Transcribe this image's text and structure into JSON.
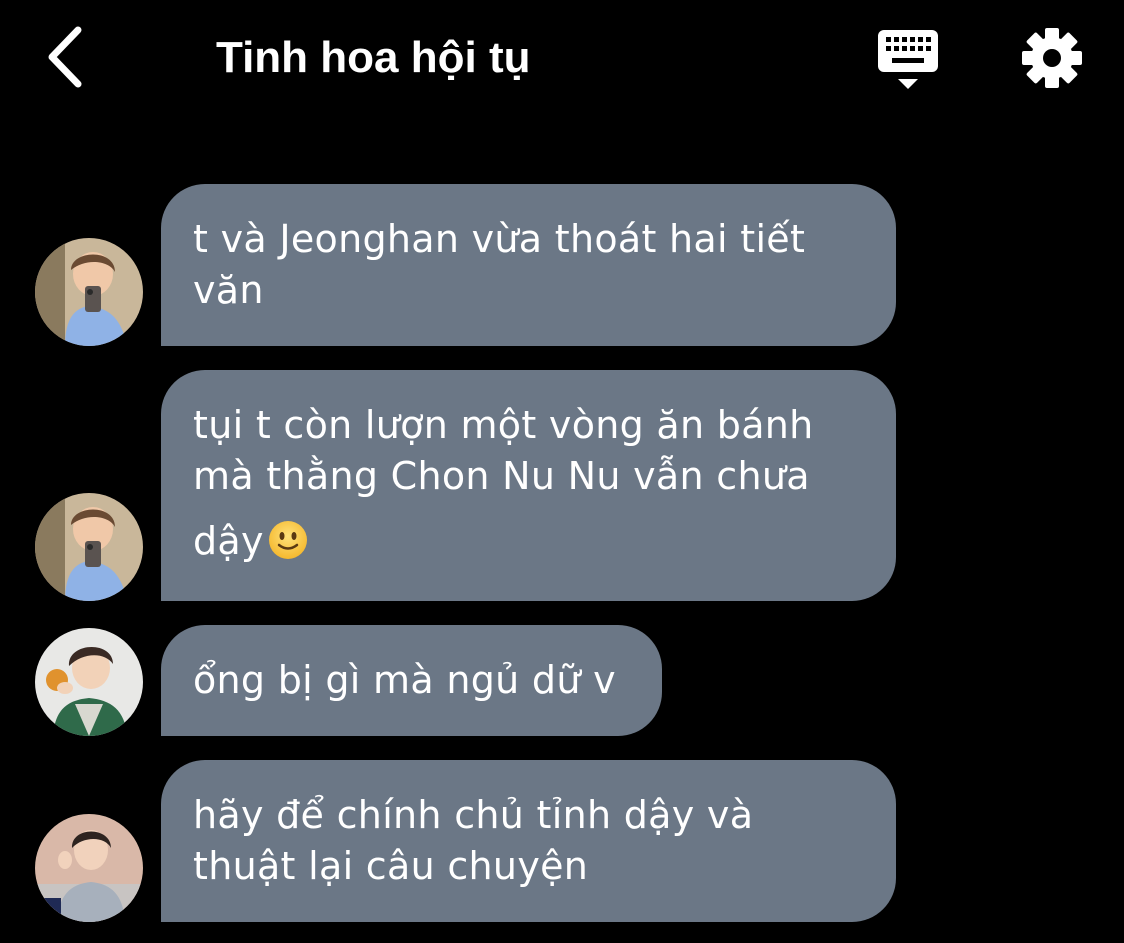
{
  "header": {
    "title": "Tinh hoa hội tụ",
    "back_icon": "chevron-left-icon",
    "keyboard_icon": "keyboard-icon",
    "settings_icon": "gear-icon"
  },
  "colors": {
    "background": "#000000",
    "bubble": "#6b7786",
    "text": "#ffffff"
  },
  "messages": [
    {
      "avatar": "avatar-1",
      "lines": [
        "t và Jeonghan vừa thoát hai tiết",
        "văn"
      ]
    },
    {
      "avatar": "avatar-1",
      "lines": [
        "tụi t còn lượn một vòng ăn bánh",
        "mà thằng Chon Nu Nu vẫn chưa",
        "dậy"
      ],
      "emoji": "slightly-smiling-face-icon"
    },
    {
      "avatar": "avatar-2",
      "lines": [
        "ổng bị gì mà ngủ dữ v"
      ]
    },
    {
      "avatar": "avatar-3",
      "lines": [
        "hãy để chính chủ tỉnh dậy và",
        "thuật lại câu chuyện"
      ]
    }
  ]
}
